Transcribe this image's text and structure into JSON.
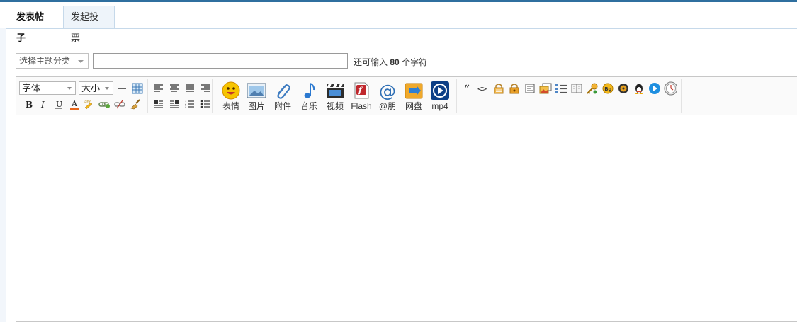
{
  "tabs": [
    {
      "label": "发表帖子",
      "active": true
    },
    {
      "label": "发起投票",
      "active": false
    }
  ],
  "subject": {
    "category_select": "选择主题分类",
    "title_value": "",
    "remaining_prefix": "还可输入",
    "remaining_count": "80",
    "remaining_suffix": "个字符"
  },
  "toolbar": {
    "font_label": "字体",
    "size_label": "大小",
    "media_buttons": [
      {
        "label": "表情",
        "icon": "smiley-icon"
      },
      {
        "label": "图片",
        "icon": "image-icon"
      },
      {
        "label": "附件",
        "icon": "paperclip-icon"
      },
      {
        "label": "音乐",
        "icon": "music-note-icon"
      },
      {
        "label": "视频",
        "icon": "video-clapper-icon"
      },
      {
        "label": "Flash",
        "icon": "flash-icon"
      },
      {
        "label": "@朋",
        "icon": "at-icon"
      },
      {
        "label": "网盘",
        "icon": "cloud-disk-icon"
      },
      {
        "label": "mp4",
        "icon": "mp4-play-icon"
      }
    ],
    "quote_glyph": "“",
    "code_glyph": "<>",
    "bg_glyph": "Bg"
  },
  "colors": {
    "accent": "#2f6f9f",
    "border": "#c6d9ea"
  }
}
